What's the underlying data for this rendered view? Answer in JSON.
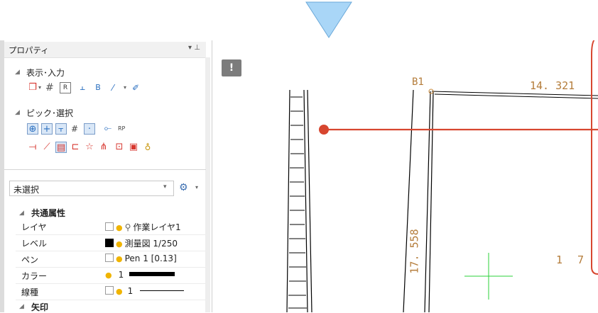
{
  "panel": {
    "title": "プロパティ",
    "pin_glyph": "▾ ⊥",
    "sections": {
      "display_input": "表示･入力",
      "pick_select": "ピック･選択",
      "common_attrs": "共通属性",
      "arrow": "矢印"
    },
    "dropdown": {
      "value": "未選択"
    },
    "properties": [
      {
        "label": "レイヤ",
        "value": "作業レイヤ1",
        "swatch": "empty",
        "icon": "search-icon"
      },
      {
        "label": "レベル",
        "value": "測量図 1/250",
        "swatch": "black"
      },
      {
        "label": "ペン",
        "value": "Pen 1 [0.13]",
        "swatch": "empty"
      },
      {
        "label": "カラー",
        "value": "1",
        "swatch": "none"
      },
      {
        "label": "線種",
        "value": "1",
        "swatch": "empty"
      }
    ]
  },
  "canvas": {
    "warning_badge": "!",
    "point_label": "B1",
    "distance_label": "14. 321",
    "lot_label": "1 7",
    "vertical_distance_label": "17. 558"
  },
  "colors": {
    "accent_red": "#d7462f",
    "annotation_brown": "#b47c3a",
    "cross_green": "#2bd13a",
    "pointer_blue": "#9fd0f5"
  }
}
